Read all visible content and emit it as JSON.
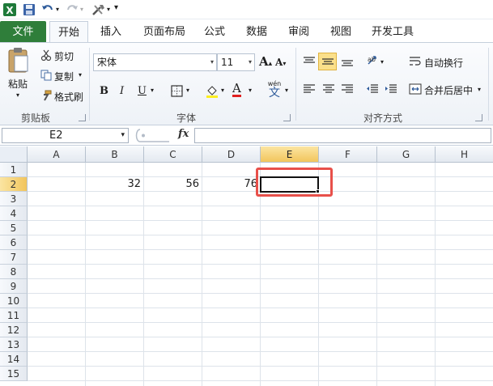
{
  "tabs": {
    "file": "文件",
    "items": [
      "开始",
      "插入",
      "页面布局",
      "公式",
      "数据",
      "审阅",
      "视图",
      "开发工具"
    ]
  },
  "ribbon": {
    "clipboard": {
      "paste": "粘贴",
      "cut": "剪切",
      "copy": "复制",
      "format_painter": "格式刷",
      "label": "剪贴板"
    },
    "font": {
      "name": "宋体",
      "size": "11",
      "bold": "B",
      "italic": "I",
      "underline": "U",
      "label": "字体",
      "wen": "wén",
      "wen_char": "文"
    },
    "alignment": {
      "wrap_text": "自动换行",
      "merge_center": "合并后居中",
      "label": "对齐方式"
    }
  },
  "formula_bar": {
    "name_box": "E2",
    "fx": "fx",
    "formula": ""
  },
  "sheet": {
    "columns": [
      "A",
      "B",
      "C",
      "D",
      "E",
      "F",
      "G",
      "H"
    ],
    "rows": [
      "1",
      "2",
      "3",
      "4",
      "5",
      "6",
      "7",
      "8",
      "9",
      "10",
      "11",
      "12",
      "13",
      "14",
      "15"
    ],
    "cells": {
      "B2": "32",
      "C2": "56",
      "D2": "76"
    },
    "selected": "E2"
  },
  "colors": {
    "file_tab": "#2f7e3a",
    "selection_highlight": "#e8504a",
    "header_selected": "#f2c55c"
  }
}
